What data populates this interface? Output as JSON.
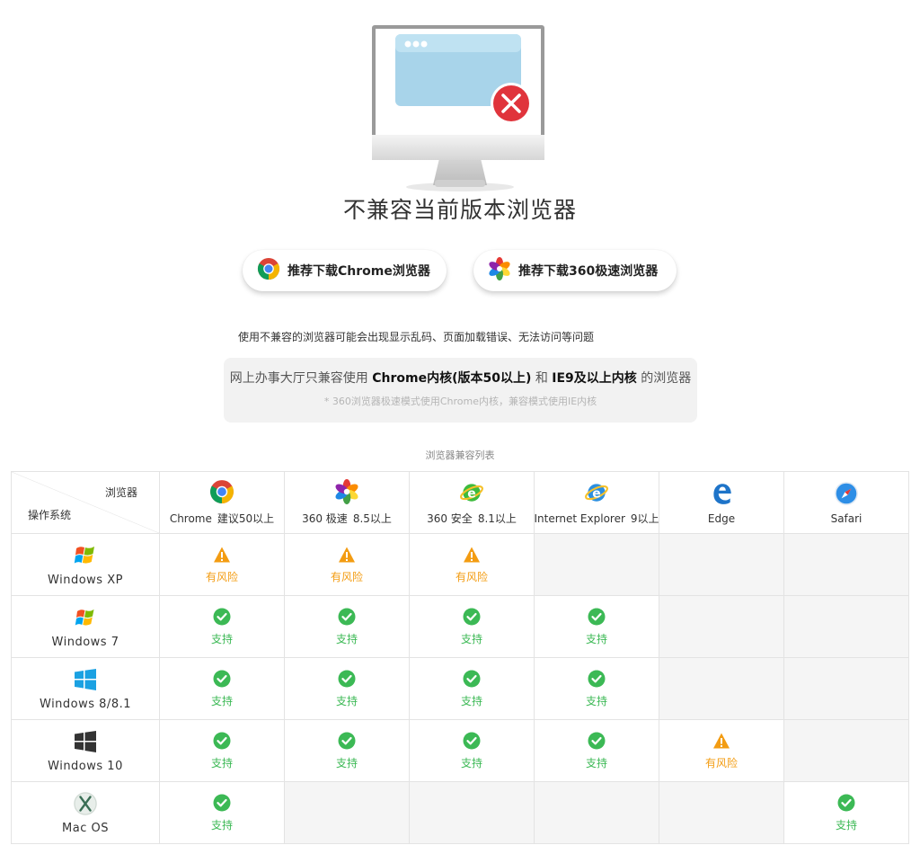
{
  "page": {
    "title": "不兼容当前版本浏览器",
    "buttons": {
      "chrome": "推荐下载Chrome浏览器",
      "b360": "推荐下载360极速浏览器"
    },
    "notice": "使用不兼容的浏览器可能会出现显示乱码、页面加载错误、无法访问等问题",
    "info": {
      "pre": "网上办事大厅只兼容使用",
      "bold1": "Chrome内核(版本50以上)",
      "mid": "和",
      "bold2": "IE9及以上内核",
      "post": "的浏览器",
      "footnote": "* 360浏览器极速模式使用Chrome内核，兼容模式使用IE内核"
    }
  },
  "table": {
    "caption": "浏览器兼容列表",
    "corner_browser": "浏览器",
    "corner_os": "操作系统",
    "browsers": [
      {
        "name": "Chrome",
        "version": "建议50以上",
        "icon": "chrome-icon"
      },
      {
        "name": "360 极速",
        "version": "8.5以上",
        "icon": "360-speed-icon"
      },
      {
        "name": "360 安全",
        "version": "8.1以上",
        "icon": "360-safe-icon"
      },
      {
        "name": "Internet Explorer",
        "version": "9以上",
        "icon": "ie-icon"
      },
      {
        "name": "Edge",
        "version": "",
        "icon": "edge-icon"
      },
      {
        "name": "Safari",
        "version": "",
        "icon": "safari-icon"
      }
    ],
    "status_labels": {
      "ok": "支持",
      "risk": "有风险"
    },
    "rows": [
      {
        "os": "Windows XP",
        "icon": "windows-xp-icon",
        "cells": [
          "risk",
          "risk",
          "risk",
          "none",
          "none",
          "none"
        ]
      },
      {
        "os": "Windows 7",
        "icon": "windows-7-icon",
        "cells": [
          "ok",
          "ok",
          "ok",
          "ok",
          "none",
          "none"
        ]
      },
      {
        "os": "Windows 8/8.1",
        "icon": "windows-8-icon",
        "cells": [
          "ok",
          "ok",
          "ok",
          "ok",
          "none",
          "none"
        ]
      },
      {
        "os": "Windows 10",
        "icon": "windows-10-icon",
        "cells": [
          "ok",
          "ok",
          "ok",
          "ok",
          "risk",
          "none"
        ]
      },
      {
        "os": "Mac OS",
        "icon": "mac-os-icon",
        "cells": [
          "ok",
          "none",
          "none",
          "none",
          "none",
          "ok"
        ]
      }
    ]
  },
  "colors": {
    "ok": "#3cb955",
    "risk": "#f39c12",
    "empty_cell": "#f5f5f5",
    "error_badge": "#e0343c"
  }
}
